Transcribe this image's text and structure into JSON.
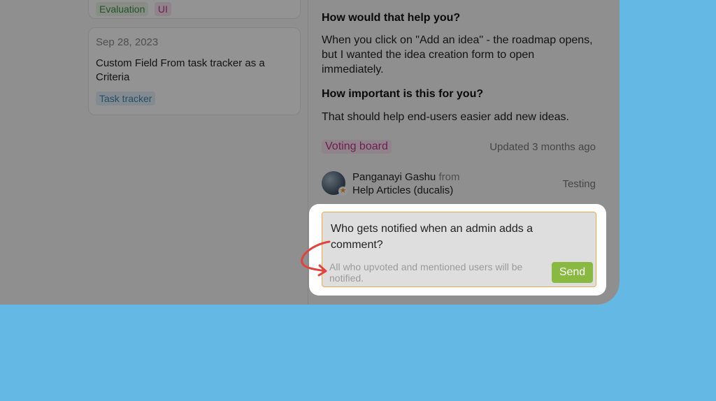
{
  "left_cards": [
    {
      "tags": [
        "Evaluation",
        "UI"
      ]
    },
    {
      "date": "Sep 28, 2023",
      "title": "Custom Field From task tracker as a Criteria",
      "tags": [
        "Task tracker"
      ]
    }
  ],
  "idea": {
    "q1_heading": "How would that help you?",
    "q1_answer": "When you click on \"Add an idea\" - the roadmap opens, but I wanted the idea creation form to open immediately.",
    "q2_heading": "How important is this for you?",
    "q2_answer": "That should help end-users easier add new ideas.",
    "board_tag": "Voting board",
    "updated": "Updated 3 months ago",
    "author_name": "Panganayi Gashu",
    "author_from": "from",
    "author_source": "Help Articles (ducalis)",
    "status": "Testing"
  },
  "comment": {
    "text": "Who gets notified when an admin adds a comment?",
    "hint": "All who upvoted and mentioned users will be notified.",
    "send_label": "Send"
  },
  "colors": {
    "background": "#63b8e4",
    "send_button": "#8ab941",
    "focus_border": "#f0a84a",
    "arrow": "#e0443e"
  },
  "icons": {
    "avatar_badge": "star-icon",
    "pointer": "curved-arrow-icon"
  }
}
